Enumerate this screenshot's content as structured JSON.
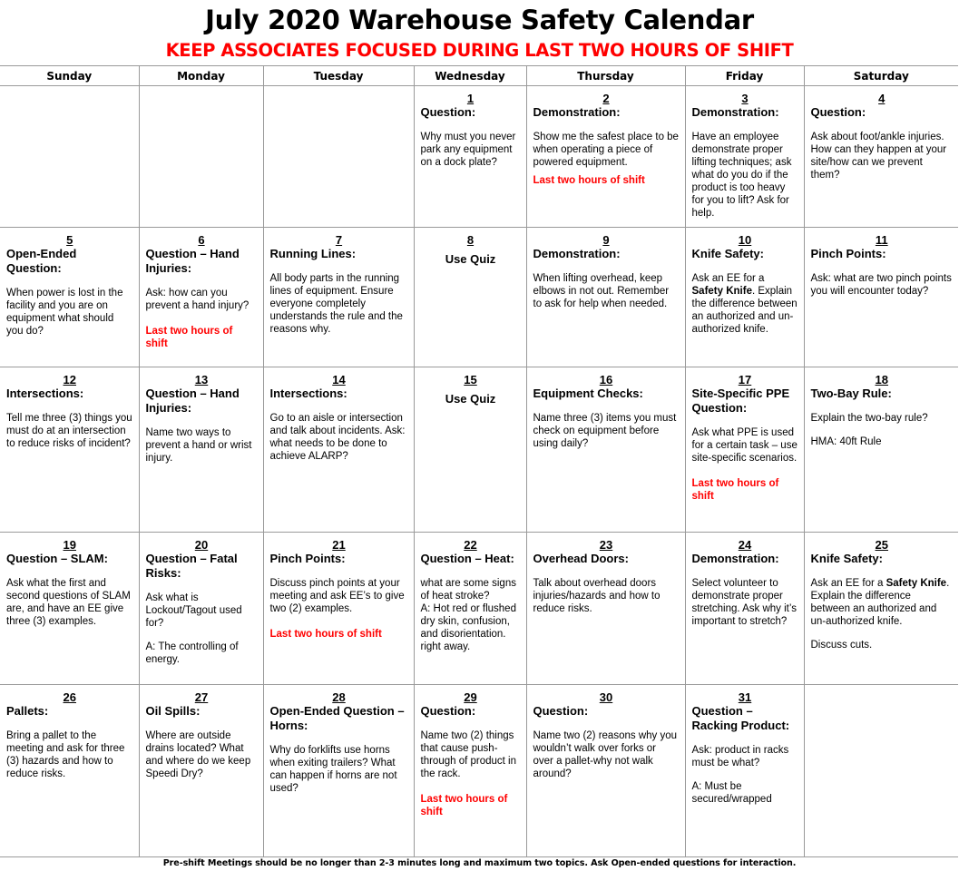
{
  "header": {
    "title": "July 2020 Warehouse Safety Calendar",
    "subtitle": "KEEP ASSOCIATES FOCUSED DURING LAST TWO HOURS OF SHIFT"
  },
  "weekdays": [
    "Sunday",
    "Monday",
    "Tuesday",
    "Wednesday",
    "Thursday",
    "Friday",
    "Saturday"
  ],
  "days": {
    "d1": {
      "num": "1",
      "topic": "Question:",
      "body": "Why must you never park any equipment on a dock plate?"
    },
    "d2": {
      "num": "2",
      "topic": "Demonstration:",
      "body": "Show me the safest place to be when operating a piece of powered equipment.",
      "note": "Last two hours of shift"
    },
    "d3": {
      "num": "3",
      "topic": "Demonstration:",
      "body": "Have an employee demonstrate proper lifting techniques; ask what do you do if the product is too heavy for you to lift? Ask for help."
    },
    "d4": {
      "num": "4",
      "topic": "Question:",
      "body": "Ask about foot/ankle injuries. How can they happen at your site/how can we prevent them?"
    },
    "d5": {
      "num": "5",
      "topic": "Open-Ended Question:",
      "body": "When power is lost in the facility and you are on equipment what should you do?"
    },
    "d6": {
      "num": "6",
      "topic": "Question – Hand Injuries:",
      "body": "Ask: how can you prevent a hand injury?",
      "note": "Last two hours of shift"
    },
    "d7": {
      "num": "7",
      "topic": "Running Lines:",
      "body": "All body parts in the running lines of equipment. Ensure everyone completely understands the rule and the reasons why."
    },
    "d8": {
      "num": "8",
      "topic": "Use Quiz"
    },
    "d9": {
      "num": "9",
      "topic": "Demonstration:",
      "body": "When lifting overhead, keep elbows in not out. Remember to ask for help when needed."
    },
    "d10": {
      "num": "10",
      "topic": "Knife Safety:",
      "body_pre": "Ask an EE for a ",
      "body_bold": "Safety Knife",
      "body_post": ". Explain the difference between an authorized and un-authorized knife."
    },
    "d11": {
      "num": "11",
      "topic": "Pinch Points:",
      "body": "Ask: what are two pinch points you will encounter today?"
    },
    "d12": {
      "num": "12",
      "topic": "Intersections:",
      "body": "Tell me three (3) things you must do at an intersection to reduce risks of incident?"
    },
    "d13": {
      "num": "13",
      "topic": "Question – Hand Injuries:",
      "body": "Name two ways to prevent a hand or wrist injury."
    },
    "d14": {
      "num": "14",
      "topic": "Intersections:",
      "body": "Go to an aisle or intersection and talk about incidents. Ask: what needs to be done to achieve ALARP?"
    },
    "d15": {
      "num": "15",
      "topic": "Use Quiz"
    },
    "d16": {
      "num": "16",
      "topic": "Equipment Checks:",
      "body": "Name three (3) items you must check on equipment before using daily?"
    },
    "d17": {
      "num": "17",
      "topic": "Site-Specific PPE Question:",
      "body": "Ask what PPE is used for a certain task – use site-specific scenarios.",
      "note": "Last two hours of shift"
    },
    "d18": {
      "num": "18",
      "topic": "Two-Bay Rule:",
      "body": "Explain the two-bay rule?",
      "answer": "HMA: 40ft Rule"
    },
    "d19": {
      "num": "19",
      "topic": "Question – SLAM:",
      "body": "Ask what the first and second questions of SLAM are, and have an EE give three (3) examples."
    },
    "d20": {
      "num": "20",
      "topic": "Question – Fatal Risks:",
      "body": "Ask what is Lockout/Tagout used for?",
      "answer": "A: The controlling of energy."
    },
    "d21": {
      "num": "21",
      "topic": "Pinch Points:",
      "body": "Discuss pinch points at your meeting and ask EE’s to give two (2) examples.",
      "note": "Last two hours of shift"
    },
    "d22": {
      "num": "22",
      "topic": "Question – Heat:",
      "body": "what are some signs of heat stroke?",
      "answer": "A: Hot red or flushed dry skin, confusion, and disorientation. right away."
    },
    "d23": {
      "num": "23",
      "topic": "Overhead Doors:",
      "body": "Talk about overhead doors injuries/hazards and how to reduce risks."
    },
    "d24": {
      "num": "24",
      "topic": "Demonstration:",
      "body": "Select volunteer to demonstrate proper stretching. Ask why it’s important to stretch?"
    },
    "d25": {
      "num": "25",
      "topic": "Knife Safety:",
      "body_pre": "Ask an EE for a ",
      "body_bold": "Safety Knife",
      "body_post": ". Explain the difference between an authorized and un-authorized knife.",
      "answer": "Discuss cuts."
    },
    "d26": {
      "num": "26",
      "topic": "Pallets:",
      "body": "Bring a pallet to the meeting and ask for three (3) hazards and how to reduce risks."
    },
    "d27": {
      "num": "27",
      "topic": "Oil Spills:",
      "body": "Where are outside drains located? What and where do we keep Speedi Dry?"
    },
    "d28": {
      "num": "28",
      "topic": "Open-Ended Question – Horns:",
      "body": "Why do forklifts use horns when exiting trailers?  What can happen if horns are not used?"
    },
    "d29": {
      "num": "29",
      "topic": "Question:",
      "body": "Name two (2) things that cause push-through of product in the rack.",
      "note": "Last two hours of shift"
    },
    "d30": {
      "num": "30",
      "topic": "Question:",
      "body": "Name two (2) reasons why you wouldn’t walk over forks or over a pallet-why not walk around?"
    },
    "d31": {
      "num": "31",
      "topic": "Question – Racking Product:",
      "body": "Ask: product in racks must be what?",
      "answer": "A: Must be secured/wrapped"
    }
  },
  "footer": {
    "note": "Pre-shift Meetings should be no longer than 2-3 minutes long and maximum two topics.  Ask Open-ended questions for interaction."
  },
  "colors": {
    "accent_red": "#ff0000",
    "grid_line": "#9a9a9a",
    "text": "#000000"
  }
}
